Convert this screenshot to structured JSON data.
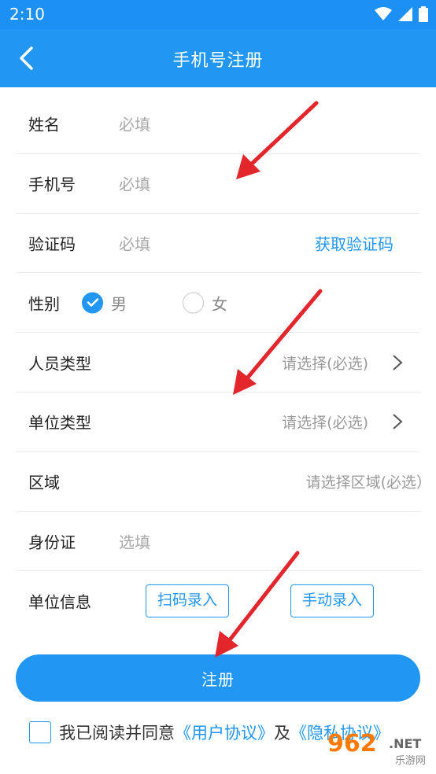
{
  "status_bar": {
    "time": "2:10"
  },
  "nav": {
    "title": "手机号注册"
  },
  "form": {
    "name": {
      "label": "姓名",
      "placeholder": "必填"
    },
    "phone": {
      "label": "手机号",
      "placeholder": "必填"
    },
    "code": {
      "label": "验证码",
      "placeholder": "必填",
      "action": "获取验证码"
    },
    "gender": {
      "label": "性别",
      "options": [
        "男",
        "女"
      ],
      "selected": "男"
    },
    "person_type": {
      "label": "人员类型",
      "placeholder": "请选择(必选)"
    },
    "unit_type": {
      "label": "单位类型",
      "placeholder": "请选择(必选)"
    },
    "area": {
      "label": "区域",
      "placeholder": "请选择区域(必选）"
    },
    "id_card": {
      "label": "身份证",
      "placeholder": "选填"
    },
    "unit_info": {
      "label": "单位信息",
      "scan_button": "扫码录入",
      "manual_button": "手动录入"
    }
  },
  "register_button": "注册",
  "agreement": {
    "prefix": "我已阅读并同意",
    "user_agreement": "《用户协议》",
    "and": "及",
    "privacy_agreement": "《隐私协议》"
  },
  "watermark": {
    "number": "962",
    "suffix": ".NET",
    "subtitle": "乐游网"
  },
  "colors": {
    "primary": "#2196f3",
    "annotation_arrow": "#e3262b",
    "watermark": "#ff7a00"
  }
}
